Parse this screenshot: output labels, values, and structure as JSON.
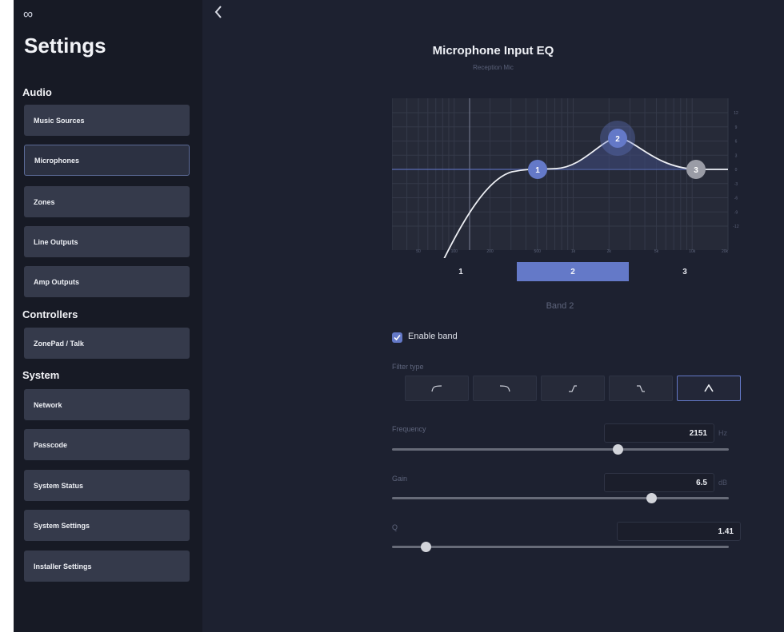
{
  "app": {
    "logo": "∞"
  },
  "sidebar": {
    "title": "Settings",
    "sections": [
      {
        "label": "Audio",
        "items": [
          "Music Sources",
          "Microphones",
          "Zones",
          "Line Outputs",
          "Amp Outputs"
        ]
      },
      {
        "label": "Controllers",
        "items": [
          "ZonePad / Talk"
        ]
      },
      {
        "label": "System",
        "items": [
          "Network",
          "Passcode",
          "System Status",
          "System Settings",
          "Installer Settings"
        ]
      }
    ],
    "active_item": "Microphones"
  },
  "main": {
    "title": "Microphone Input EQ",
    "subtitle": "Reception Mic",
    "eq_graph": {
      "gain_ticks": [
        "12",
        "9",
        "6",
        "3",
        "0",
        "-3",
        "-6",
        "-9",
        "-12"
      ],
      "freq_ticks": [
        "50",
        "100",
        "200",
        "500",
        "1k",
        "2k",
        "5k",
        "10k",
        "20k"
      ],
      "nodes": [
        {
          "label": "1",
          "freq_hz": 700,
          "gain_db": 0
        },
        {
          "label": "2",
          "freq_hz": 2151,
          "gain_db": 6.5
        },
        {
          "label": "3",
          "freq_hz": 11000,
          "gain_db": 0
        }
      ]
    },
    "band_tabs": [
      "1",
      "2",
      "3"
    ],
    "selected_band": "2",
    "band_label": "Band 2",
    "enable_band": {
      "label": "Enable band",
      "checked": true
    },
    "filter_type": {
      "label": "Filter type",
      "options": [
        "high-pass",
        "low-pass",
        "low-shelf",
        "high-shelf",
        "peak"
      ],
      "selected": "peak"
    },
    "frequency": {
      "label": "Frequency",
      "value": "2151",
      "unit": "Hz",
      "slider_fraction": 0.67
    },
    "gain": {
      "label": "Gain",
      "value": "6.5",
      "unit": "dB",
      "slider_fraction": 0.77
    },
    "q": {
      "label": "Q",
      "value": "1.41",
      "slider_fraction": 0.1
    }
  },
  "colors": {
    "accent": "#6479c8",
    "background": "#1d2130",
    "sidebar": "#171a25",
    "button": "#353a4b"
  }
}
